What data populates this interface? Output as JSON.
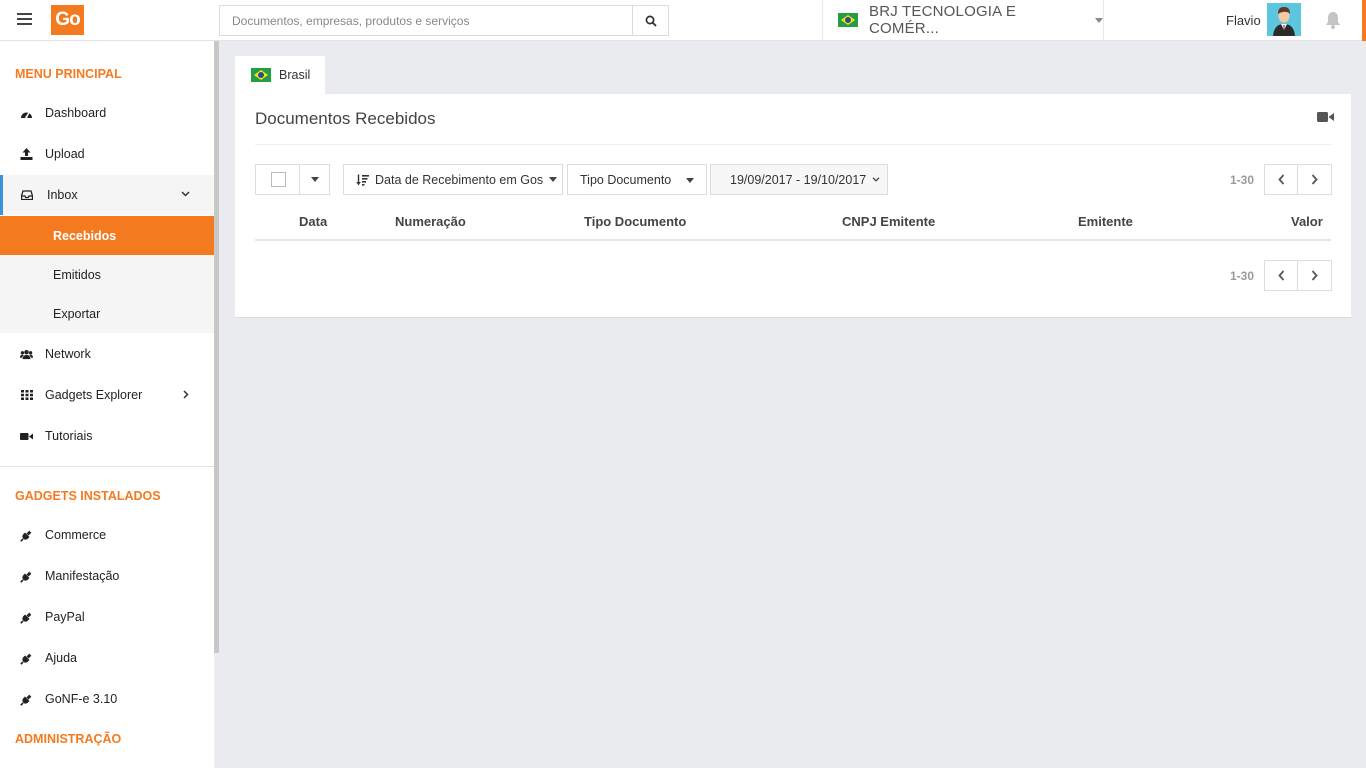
{
  "header": {
    "search_placeholder": "Documentos, empresas, produtos e serviços",
    "logo_text": "Go",
    "company_name": "BRJ TECNOLOGIA E COMÉR...",
    "user_name": "Flavio"
  },
  "sidebar": {
    "menu_title": "MENU PRINCIPAL",
    "items": [
      {
        "label": "Dashboard",
        "icon": "dashboard-icon"
      },
      {
        "label": "Upload",
        "icon": "upload-icon"
      },
      {
        "label": "Inbox",
        "icon": "inbox-icon"
      },
      {
        "label": "Network",
        "icon": "users-icon"
      },
      {
        "label": "Gadgets Explorer",
        "icon": "grid-icon"
      },
      {
        "label": "Tutoriais",
        "icon": "video-icon"
      }
    ],
    "inbox_sub": [
      {
        "label": "Recebidos",
        "active": true
      },
      {
        "label": "Emitidos"
      },
      {
        "label": "Exportar"
      }
    ],
    "gadgets_title": "GADGETS INSTALADOS",
    "gadgets": [
      {
        "label": "Commerce",
        "icon": "plug-icon"
      },
      {
        "label": "Manifestação",
        "icon": "plug-icon"
      },
      {
        "label": "PayPal",
        "icon": "plug-icon"
      },
      {
        "label": "Ajuda",
        "icon": "plug-icon"
      },
      {
        "label": "GoNF-e 3.10",
        "icon": "plug-icon"
      }
    ],
    "admin_title": "ADMINISTRAÇÃO"
  },
  "main": {
    "tab_label": "Brasil",
    "title": "Documentos Recebidos",
    "sort_label": "Data de Recebimento em Gos",
    "type_label": "Tipo Documento",
    "date_range": "19/09/2017 - 19/10/2017",
    "pager_count": "1-30",
    "columns": [
      "Data",
      "Numeração",
      "Tipo Documento",
      "CNPJ Emitente",
      "Emitente",
      "Valor"
    ]
  },
  "colors": {
    "accent": "#f47a20",
    "inbox_border": "#3b94d9",
    "background": "#e9ebee"
  }
}
